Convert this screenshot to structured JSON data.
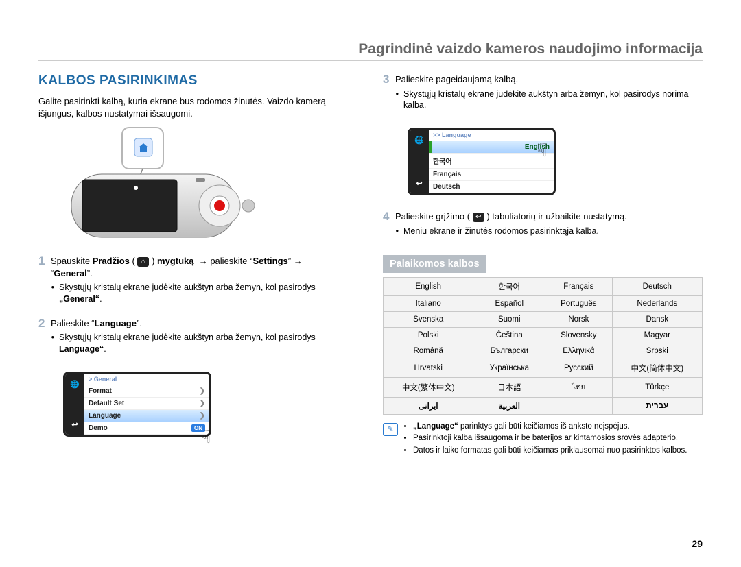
{
  "header": "Pagrindinė vaizdo kameros naudojimo informacija",
  "section_title": "KALBOS PASIRINKIMAS",
  "intro": "Galite pasirinkti kalbą, kuria ekrane bus rodomos žinutės. Vaizdo kamerą išjungus, kalbos nustatymai išsaugomi.",
  "step1": {
    "num": "1",
    "text_a": "Spauskite ",
    "text_b": "Pradžios",
    "text_c": " ( ",
    "text_d": " ) ",
    "text_e": "mygtuką",
    "arrow": "→",
    "text_f": " palieskite “",
    "text_g": "Settings",
    "text_h": "” ",
    "text_i": "“",
    "text_j": "General",
    "text_k": "”.",
    "bullet": "Skystųjų kristalų ekrane judėkite aukštyn arba žemyn, kol pasirodys ",
    "bullet_bold": "„General“",
    "bullet_end": "."
  },
  "step2": {
    "num": "2",
    "text": "Palieskite “",
    "bold": "Language",
    "end": "”.",
    "bullet": "Skystųjų kristalų ekrane judėkite aukštyn arba žemyn, kol pasirodys ",
    "bullet_bold": "Language“",
    "bullet_end": "."
  },
  "menu_general": {
    "header": "> General",
    "rows": [
      "Format",
      "Default Set",
      "Language",
      "Demo"
    ],
    "highlight_index": 2,
    "on_index": 3
  },
  "step3": {
    "num": "3",
    "text": "Palieskite pageidaujamą kalbą.",
    "bullet": "Skystųjų kristalų ekrane judėkite aukštyn arba žemyn, kol pasirodys norima kalba."
  },
  "menu_language": {
    "header": ">> Language",
    "rows": [
      "English",
      "한국어",
      "Français",
      "Deutsch"
    ],
    "highlight_index": 0
  },
  "step4": {
    "num": "4",
    "text_a": "Palieskite grįžimo ( ",
    "text_b": " ) tabuliatorių ir užbaikite nustatymą.",
    "bullet": "Meniu ekrane ir žinutės rodomos pasirinktąja kalba."
  },
  "supported_heading": "Palaikomos kalbos",
  "lang_table": [
    [
      "English",
      "한국어",
      "Français",
      "Deutsch"
    ],
    [
      "Italiano",
      "Español",
      "Português",
      "Nederlands"
    ],
    [
      "Svenska",
      "Suomi",
      "Norsk",
      "Dansk"
    ],
    [
      "Polski",
      "Čeština",
      "Slovensky",
      "Magyar"
    ],
    [
      "Română",
      "Български",
      "Ελληνικά",
      "Srpski"
    ],
    [
      "Hrvatski",
      "Українська",
      "Русский",
      "中文(简体中文)"
    ],
    [
      "中文(繁体中文)",
      "日本語",
      "ไทย",
      "Türkçe"
    ],
    [
      "ایرانی",
      "العربية",
      "",
      "עברית"
    ]
  ],
  "note": {
    "b1_a": "„Language“",
    "b1_b": " parinktys gali būti keičiamos iš anksto neįspėjus.",
    "b2": "Pasirinktoji kalba išsaugoma ir be baterijos ar kintamosios srovės adapterio.",
    "b3": "Datos ir laiko formatas gali būti keičiamas priklausomai nuo pasirinktos kalbos."
  },
  "page_num": "29"
}
